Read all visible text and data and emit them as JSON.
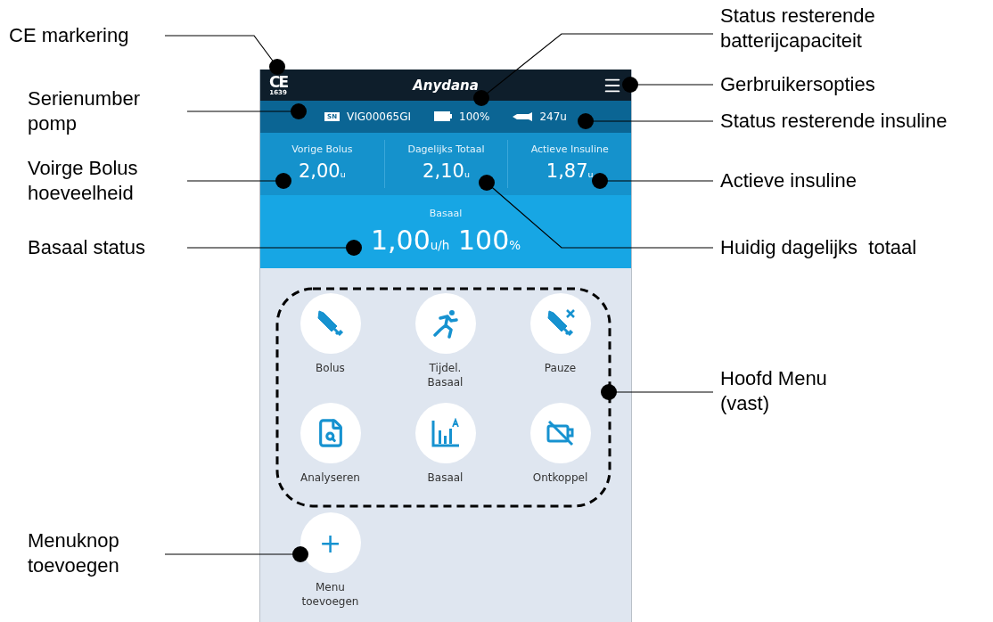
{
  "annotations_left": [
    {
      "text": "CE markering"
    },
    {
      "text": "Serienumber\npomp"
    },
    {
      "text": "Voirge Bolus\nhoeveelheid"
    },
    {
      "text": "Basaal status"
    },
    {
      "text": "Menuknop\ntoevoegen"
    }
  ],
  "annotations_right": [
    {
      "text": "Status resterende\nbatterijcapaciteit"
    },
    {
      "text": "Gerbruikersopties"
    },
    {
      "text": "Status resterende insuline"
    },
    {
      "text": "Actieve insuline"
    },
    {
      "text": "Huidig dagelijks  totaal"
    },
    {
      "text": "Hoofd Menu\n(vast)"
    }
  ],
  "header": {
    "ce_mark": "CE",
    "ce_number": "1639",
    "logo": "Anydana"
  },
  "info_bar": {
    "sn_badge": "SN",
    "serial": "VIG00065GI",
    "battery": "100%",
    "insulin": "247u"
  },
  "stats": [
    {
      "label": "Vorige Bolus",
      "value": "2,00$_{u}$"
    },
    {
      "label": "Dagelijks Totaal",
      "value": "2,10$_{u}$"
    },
    {
      "label": "Actieve Insuline",
      "value": "1,87$_{u}$"
    }
  ],
  "basal": {
    "label": "Basaal",
    "value": "1,00$_{u/h}$ 100$_{%}$"
  },
  "menu": [
    {
      "label": "Bolus"
    },
    {
      "label": "Tijdel.\nBasaal"
    },
    {
      "label": "Pauze"
    },
    {
      "label": "Analyseren"
    },
    {
      "label": "Basaal"
    },
    {
      "label": "Ontkoppel"
    }
  ],
  "add_button": {
    "symbol": "+",
    "label": "Menu\ntoevoegen"
  }
}
